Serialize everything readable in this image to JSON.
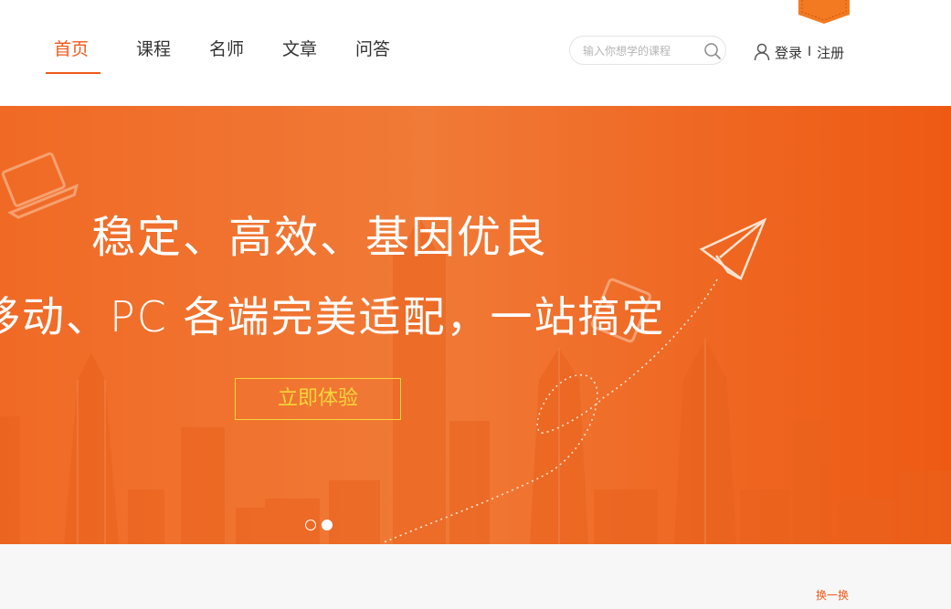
{
  "nav": {
    "items": [
      {
        "label": "首页",
        "active": true
      },
      {
        "label": "课程",
        "active": false
      },
      {
        "label": "名师",
        "active": false
      },
      {
        "label": "文章",
        "active": false
      },
      {
        "label": "问答",
        "active": false
      }
    ]
  },
  "search": {
    "placeholder": "输入你想学的课程",
    "icon": "search-icon"
  },
  "auth": {
    "login_label": "登录",
    "separator": "I",
    "register_label": "注册"
  },
  "banner": {
    "headline_line1": "稳定、高效、基因优良",
    "headline_line2": "移动、PC 各端完美适配，一站搞定",
    "cta_label": "立即体验",
    "slides": [
      {
        "active": false
      },
      {
        "active": true
      }
    ]
  },
  "section": {
    "refresh_label": "换一换"
  },
  "colors": {
    "accent": "#ee5a1a",
    "banner_start": "#f06a25",
    "banner_end": "#ee5a14",
    "cta": "#f6d63a"
  }
}
